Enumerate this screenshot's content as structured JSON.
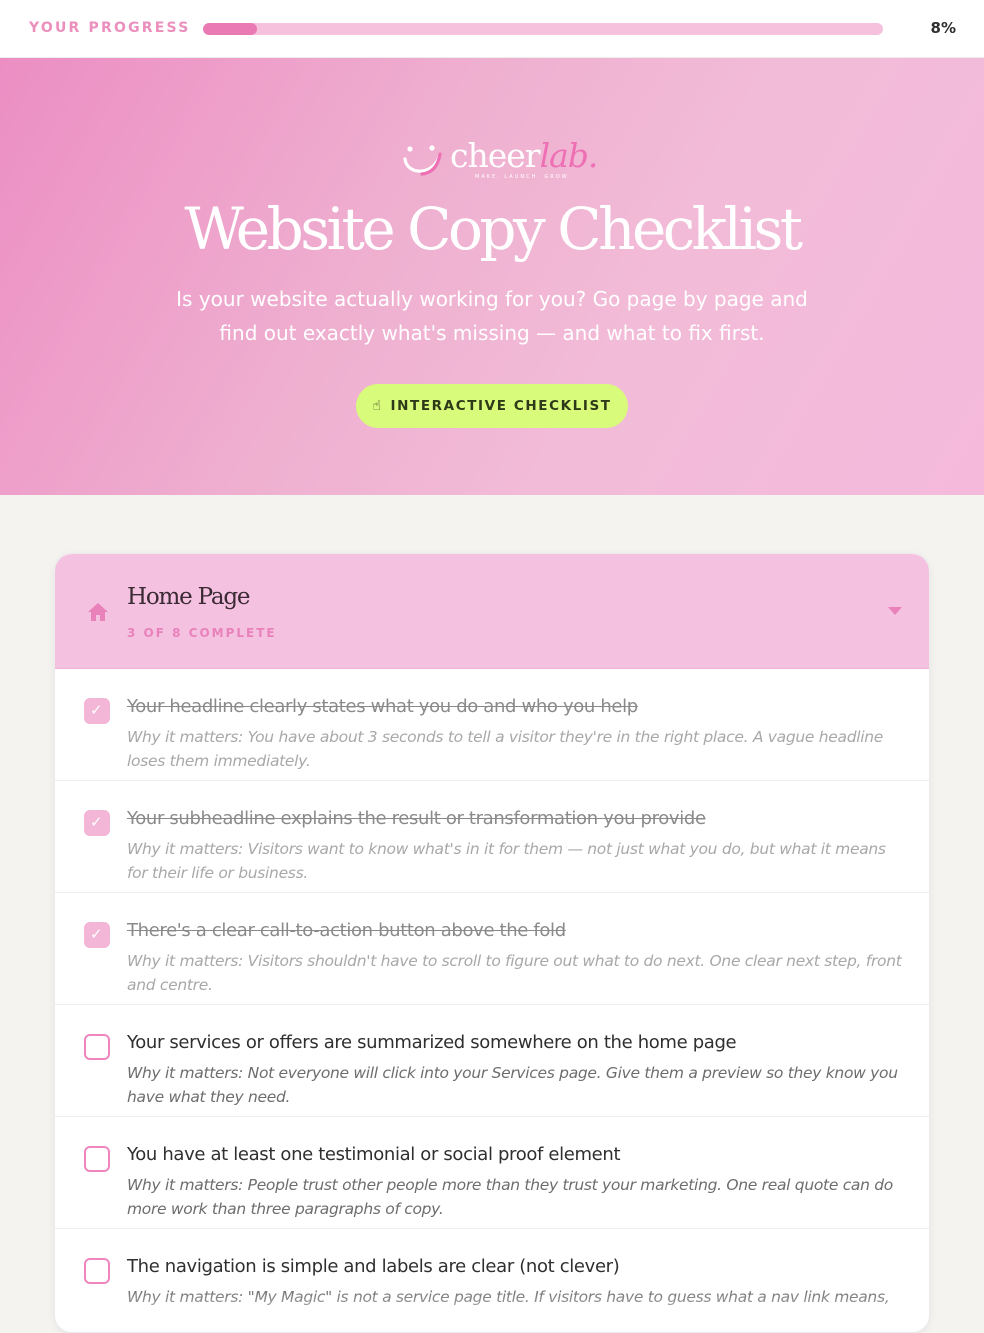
{
  "progress": {
    "label": "YOUR PROGRESS",
    "value": 0.08,
    "percent_text": "8%"
  },
  "hero": {
    "logo": {
      "brand": "cheer",
      "brand_accent": "lab.",
      "tagline": "MAKE. LAUNCH. GROW"
    },
    "title": "Website Copy Checklist",
    "subtitle": "Is your website actually working for you? Go page by page and find out exactly what's missing — and what to fix first.",
    "button_label": "INTERACTIVE CHECKLIST",
    "button_icon": "pointer-hand-icon"
  },
  "section": {
    "icon": "home-icon",
    "title": "Home Page",
    "count": "3 OF 8 COMPLETE",
    "items": [
      {
        "checked": true,
        "title": "Your headline clearly states what you do and who you help",
        "why": "Why it matters: You have about 3 seconds to tell a visitor they're in the right place. A vague headline loses them immediately."
      },
      {
        "checked": true,
        "title": "Your subheadline explains the result or transformation you provide",
        "why": "Why it matters: Visitors want to know what's in it for them — not just what you do, but what it means for their life or business."
      },
      {
        "checked": true,
        "title": "There's a clear call-to-action button above the fold",
        "why": "Why it matters: Visitors shouldn't have to scroll to figure out what to do next. One clear next step, front and centre."
      },
      {
        "checked": false,
        "title": "Your services or offers are summarized somewhere on the home page",
        "why": "Why it matters: Not everyone will click into your Services page. Give them a preview so they know you have what they need."
      },
      {
        "checked": false,
        "title": "You have at least one testimonial or social proof element",
        "why": "Why it matters: People trust other people more than they trust your marketing. One real quote can do more work than three paragraphs of copy."
      },
      {
        "checked": false,
        "title": "The navigation is simple and labels are clear (not clever)",
        "why": "Why it matters: \"My Magic\" is not a service page title. If visitors have to guess what a nav link means,"
      }
    ]
  },
  "colors": {
    "accent_pink": "#e97ab4",
    "hero_pink": "#efb0d0",
    "lime": "#d9fb7c"
  }
}
